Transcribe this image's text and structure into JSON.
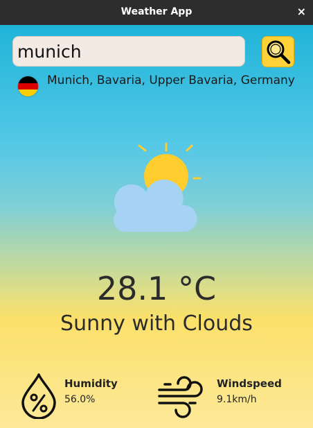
{
  "window": {
    "title": "Weather App",
    "close_glyph": "×"
  },
  "search": {
    "value": "munich",
    "button_icon": "magnifier-icon"
  },
  "location": {
    "country_flag": "germany-flag",
    "flag_colors": [
      "#000000",
      "#dd0000",
      "#ffce00"
    ],
    "name": "Munich, Bavaria, Upper Bavaria, Germany"
  },
  "current": {
    "icon": "sun-behind-cloud-icon",
    "temperature": "28.1 °C",
    "condition": "Sunny with Clouds"
  },
  "stats": {
    "humidity": {
      "label": "Humidity",
      "value": "56.0%",
      "icon": "humidity-drop-icon"
    },
    "windspeed": {
      "label": "Windspeed",
      "value": "9.1km/h",
      "icon": "wind-icon"
    }
  },
  "colors": {
    "accent": "#ffd23a",
    "sun": "#ffcd2e",
    "cloud": "#a6d2f4",
    "text": "#2b2b2b"
  }
}
